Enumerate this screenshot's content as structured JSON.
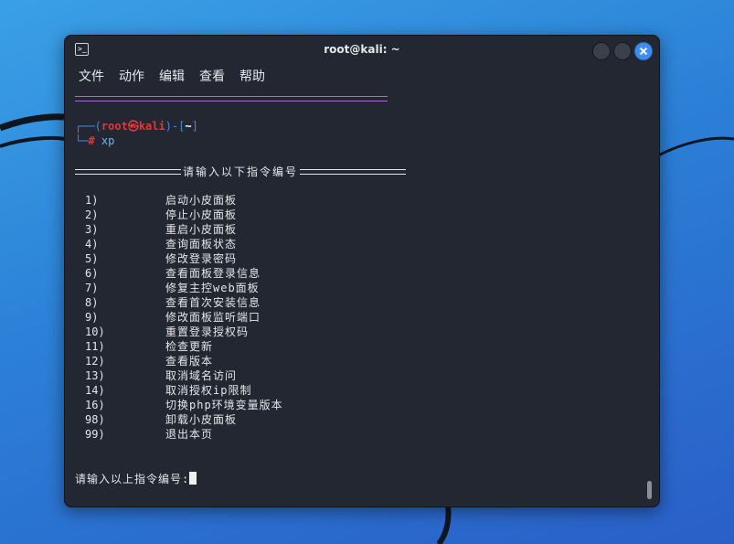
{
  "window": {
    "title": "root@kali: ~"
  },
  "menubar": [
    "文件",
    "动作",
    "编辑",
    "查看",
    "帮助"
  ],
  "prompt": {
    "open": "┌──(",
    "user": "root",
    "at": "㉿",
    "host": "kali",
    "mid": ")-[",
    "dir": "~",
    "close": "]",
    "corner": "└─",
    "hash": "#",
    "command": "xp"
  },
  "menu_title": "请输入以下指令编号",
  "options": [
    {
      "num": "1)",
      "text": "启动小皮面板"
    },
    {
      "num": "2)",
      "text": "停止小皮面板"
    },
    {
      "num": "3)",
      "text": "重启小皮面板"
    },
    {
      "num": "4)",
      "text": "查询面板状态"
    },
    {
      "num": "5)",
      "text": "修改登录密码"
    },
    {
      "num": "6)",
      "text": "查看面板登录信息"
    },
    {
      "num": "7)",
      "text": "修复主控web面板"
    },
    {
      "num": "8)",
      "text": "查看首次安装信息"
    },
    {
      "num": "9)",
      "text": "修改面板监听端口"
    },
    {
      "num": "10)",
      "text": "重置登录授权码"
    },
    {
      "num": "11)",
      "text": "检查更新"
    },
    {
      "num": "12)",
      "text": "查看版本"
    },
    {
      "num": "13)",
      "text": "取消域名访问"
    },
    {
      "num": "14)",
      "text": "取消授权ip限制"
    },
    {
      "num": "16)",
      "text": "切换php环境变量版本"
    },
    {
      "num": "98)",
      "text": "卸载小皮面板"
    },
    {
      "num": "99)",
      "text": "退出本页"
    }
  ],
  "input_prompt": "请输入以上指令编号:",
  "colors": {
    "accent": "#3d8ef0",
    "prompt_red": "#e8333a",
    "prompt_blue": "#3f8ae6",
    "terminal_bg": "#232732"
  }
}
